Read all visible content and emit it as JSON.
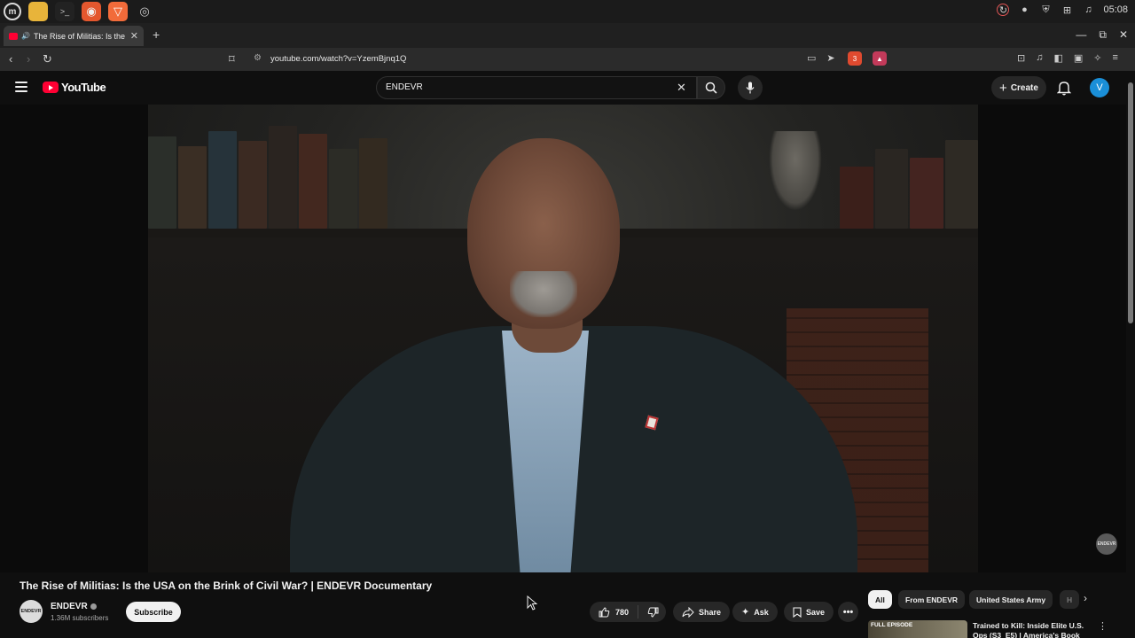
{
  "os": {
    "clock": "05:08",
    "apps": [
      "mint-menu-icon",
      "files-icon",
      "terminal-icon",
      "firefox-icon",
      "brave-icon",
      "chromium-icon"
    ]
  },
  "browser": {
    "tab_title": "The Rise of Militias: Is the U",
    "url": "youtube.com/watch?v=YzemBjnq1Q",
    "extension_badge": "3"
  },
  "youtube": {
    "logo_text": "YouTube",
    "search_value": "ENDEVR",
    "create_label": "Create",
    "avatar_letter": "V"
  },
  "video": {
    "title": "The Rise of Militias: Is the USA on the Brink of Civil War? | ENDEVR Documentary",
    "watermark": "ENDEVR",
    "channel": {
      "name": "ENDEVR",
      "avatar_text": "ENDEVR",
      "subscribers": "1.36M subscribers",
      "subscribe_label": "Subscribe"
    },
    "actions": {
      "likes": "780",
      "share": "Share",
      "ask": "Ask",
      "save": "Save"
    }
  },
  "sidebar": {
    "chips": [
      "All",
      "From ENDEVR",
      "United States Army",
      "H"
    ],
    "recommendation": {
      "thumb_label": "FULL EPISODE",
      "title": "Trained to Kill: Inside Elite U.S. Ops (S3_E5) | America's Book"
    }
  },
  "colors": {
    "background": "#0f0f0f",
    "brand_red": "#ff0033",
    "avatar_blue": "#1a8fd8"
  }
}
